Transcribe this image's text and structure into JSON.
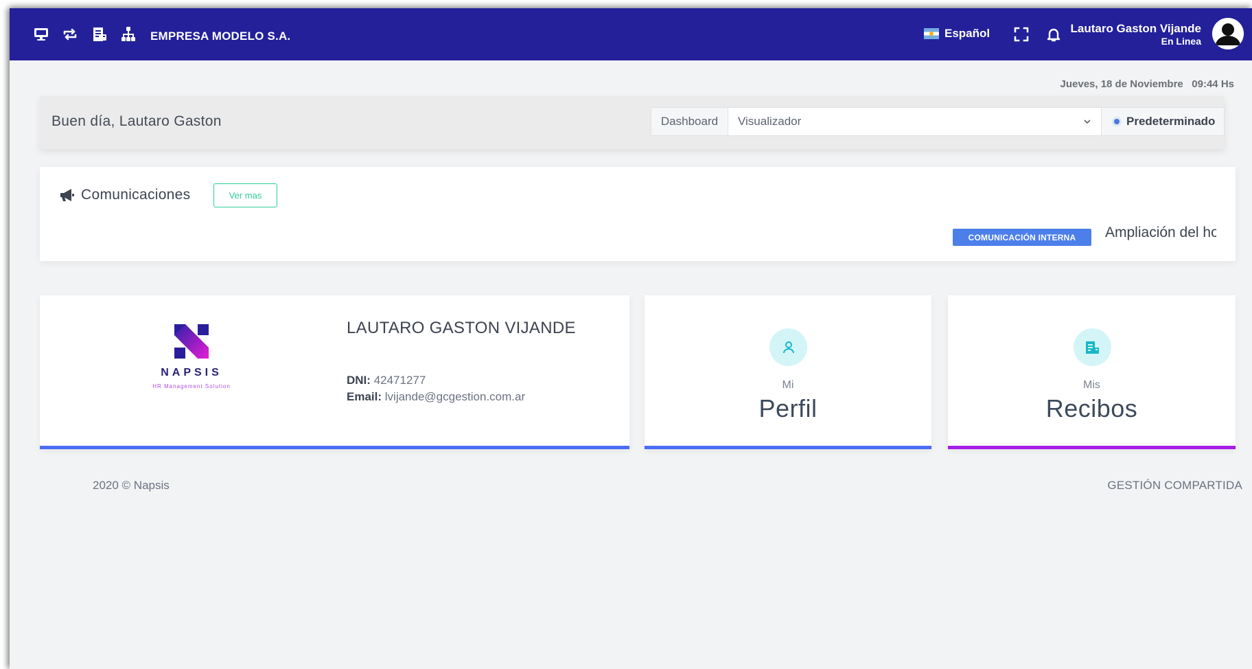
{
  "header": {
    "company": "EMPRESA MODELO S.A.",
    "language": "Español",
    "user_name": "Lautaro Gaston Vijande",
    "user_status": "En Linea",
    "bg_color": "#23209a",
    "icons": [
      "monitor-icon",
      "swap-icon",
      "receipt-icon",
      "org-chart-icon",
      "fullscreen-icon",
      "bell-icon"
    ]
  },
  "datetime": {
    "date": "Jueves, 18 de Noviembre",
    "time": "09:44 Hs"
  },
  "greeting": {
    "text": "Buen día, Lautaro Gaston",
    "dashboard_label": "Dashboard",
    "dashboard_selected": "Visualizador",
    "default_label": "Predeterminado"
  },
  "communications": {
    "title": "Comunicaciones",
    "ver_mas": "Ver mas",
    "badge": "COMUNICACIÓN INTERNA",
    "news_text": "Ampliación del horario",
    "badge_color": "#4c7fea"
  },
  "profile_card": {
    "logo_name": "NAPSIS",
    "logo_tagline": "HR Management Solution",
    "employee_name": "LAUTARO GASTON VIJANDE",
    "dni_label": "DNI:",
    "dni_value": "42471277",
    "email_label": "Email:",
    "email_value": "lvijande@gcgestion.com.ar",
    "bar_color": "#4a6cf7"
  },
  "perfil_card": {
    "sub": "Mi",
    "main": "Perfil",
    "icon": "user-icon",
    "bar_color": "#4a6cf7"
  },
  "recibos_card": {
    "sub": "Mis",
    "main": "Recibos",
    "icon": "receipt-icon",
    "bar_color": "#a41ee8"
  },
  "footer": {
    "left": "2020 © Napsis",
    "right": "GESTIÓN COMPARTIDA"
  }
}
